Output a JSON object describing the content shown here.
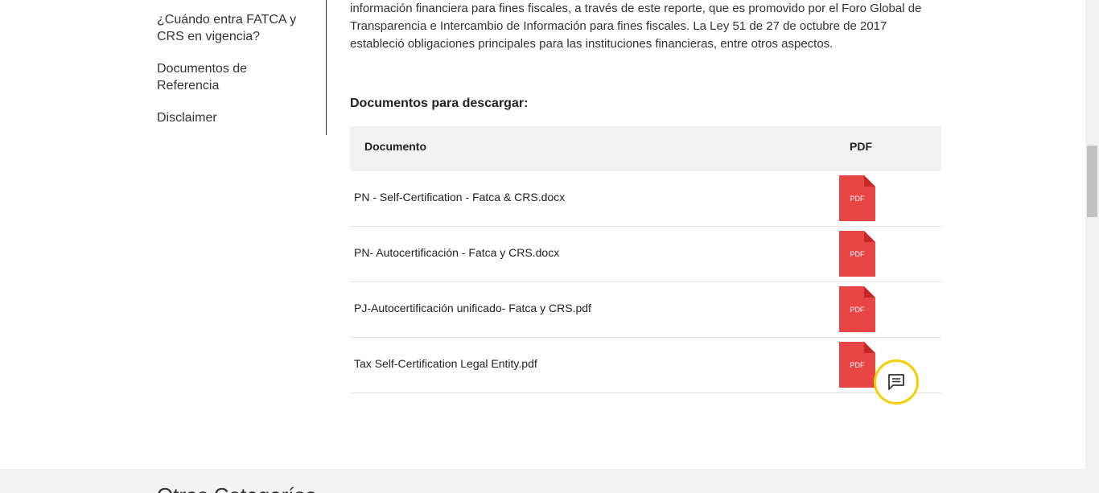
{
  "sidebar": {
    "items": [
      {
        "label": "¿Cuándo entra FATCA y CRS en vigencia?"
      },
      {
        "label": "Documentos de Referencia"
      },
      {
        "label": "Disclaimer"
      }
    ]
  },
  "main": {
    "intro_lines": [
      "información financiera para fines fiscales, a través de este reporte,  que es promovido por el Foro Global de",
      "Transparencia e Intercambio de Información para fines fiscales.  La Ley 51 de 27 de octubre de 2017",
      "estableció obligaciones principales para las instituciones financieras, entre otros aspectos."
    ],
    "downloads_heading": "Documentos para descargar:",
    "table": {
      "headers": {
        "document": "Documento",
        "pdf": "PDF"
      },
      "rows": [
        {
          "name": "PN - Self-Certification - Fatca & CRS.docx",
          "icon_label": "PDF"
        },
        {
          "name": "PN- Autocertificación - Fatca y CRS.docx",
          "icon_label": "PDF"
        },
        {
          "name": "PJ-Autocertificación unificado- Fatca y CRS.pdf",
          "icon_label": "PDF"
        },
        {
          "name": "Tax Self-Certification Legal Entity.pdf",
          "icon_label": "PDF"
        }
      ]
    }
  },
  "footer": {
    "title": "Otras Categorías"
  },
  "icons": {
    "pdf": "pdf-file-icon",
    "chat": "chat-icon"
  },
  "colors": {
    "pdf_red": "#e84545",
    "pdf_fold": "#c62828",
    "chat_ring": "#f5d000",
    "table_header_bg": "#f2f2f2"
  }
}
